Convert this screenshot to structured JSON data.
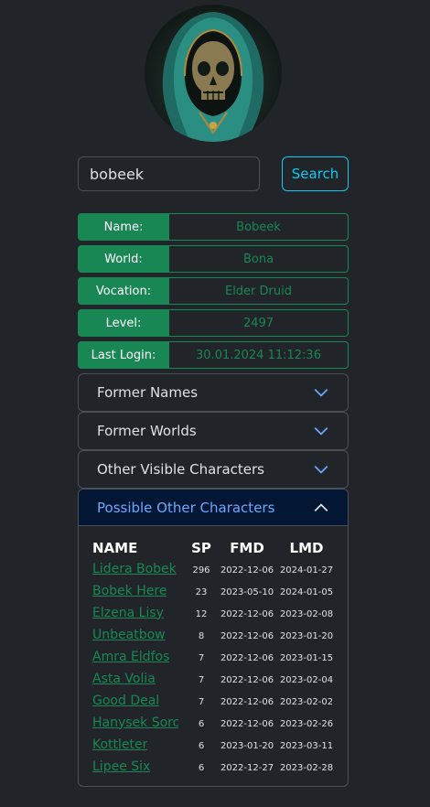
{
  "avatar": {
    "icon": "hooded-skull-avatar"
  },
  "search": {
    "value": "bobeek",
    "button_label": "Search"
  },
  "info": [
    {
      "label": "Name:",
      "value": "Bobeek"
    },
    {
      "label": "World:",
      "value": "Bona"
    },
    {
      "label": "Vocation:",
      "value": "Elder Druid"
    },
    {
      "label": "Level:",
      "value": "2497"
    },
    {
      "label": "Last Login:",
      "value": "30.01.2024 11:12:36"
    }
  ],
  "accordion": {
    "former_names": "Former Names",
    "former_worlds": "Former Worlds",
    "other_visible": "Other Visible Characters",
    "possible_other": "Possible Other Characters"
  },
  "table": {
    "headers": {
      "name": "NAME",
      "sp": "SP",
      "fmd": "FMD",
      "lmd": "LMD"
    },
    "rows": [
      {
        "name": "Lidera Bobek",
        "sp": "296",
        "fmd": "2022-12-06",
        "lmd": "2024-01-27"
      },
      {
        "name": "Bobek Here",
        "sp": "23",
        "fmd": "2023-05-10",
        "lmd": "2024-01-05"
      },
      {
        "name": "Elzena Lisy",
        "sp": "12",
        "fmd": "2022-12-06",
        "lmd": "2023-02-08"
      },
      {
        "name": "Unbeatbow",
        "sp": "8",
        "fmd": "2022-12-06",
        "lmd": "2023-01-20"
      },
      {
        "name": "Amra Eldfos",
        "sp": "7",
        "fmd": "2022-12-06",
        "lmd": "2023-01-15"
      },
      {
        "name": "Asta Volia",
        "sp": "7",
        "fmd": "2022-12-06",
        "lmd": "2023-02-04"
      },
      {
        "name": "Good Deal",
        "sp": "7",
        "fmd": "2022-12-06",
        "lmd": "2023-02-02"
      },
      {
        "name": "Hanysek Sorc",
        "sp": "6",
        "fmd": "2022-12-06",
        "lmd": "2023-02-26"
      },
      {
        "name": "Kottleter",
        "sp": "6",
        "fmd": "2023-01-20",
        "lmd": "2023-03-11"
      },
      {
        "name": "Lipee Six",
        "sp": "6",
        "fmd": "2022-12-27",
        "lmd": "2023-02-28"
      }
    ]
  },
  "colors": {
    "background": "#212529",
    "accent_green": "#198754",
    "accent_cyan": "#0dcaf0",
    "accordion_active_bg": "#031633",
    "accordion_active_text": "#6ea8fe"
  }
}
